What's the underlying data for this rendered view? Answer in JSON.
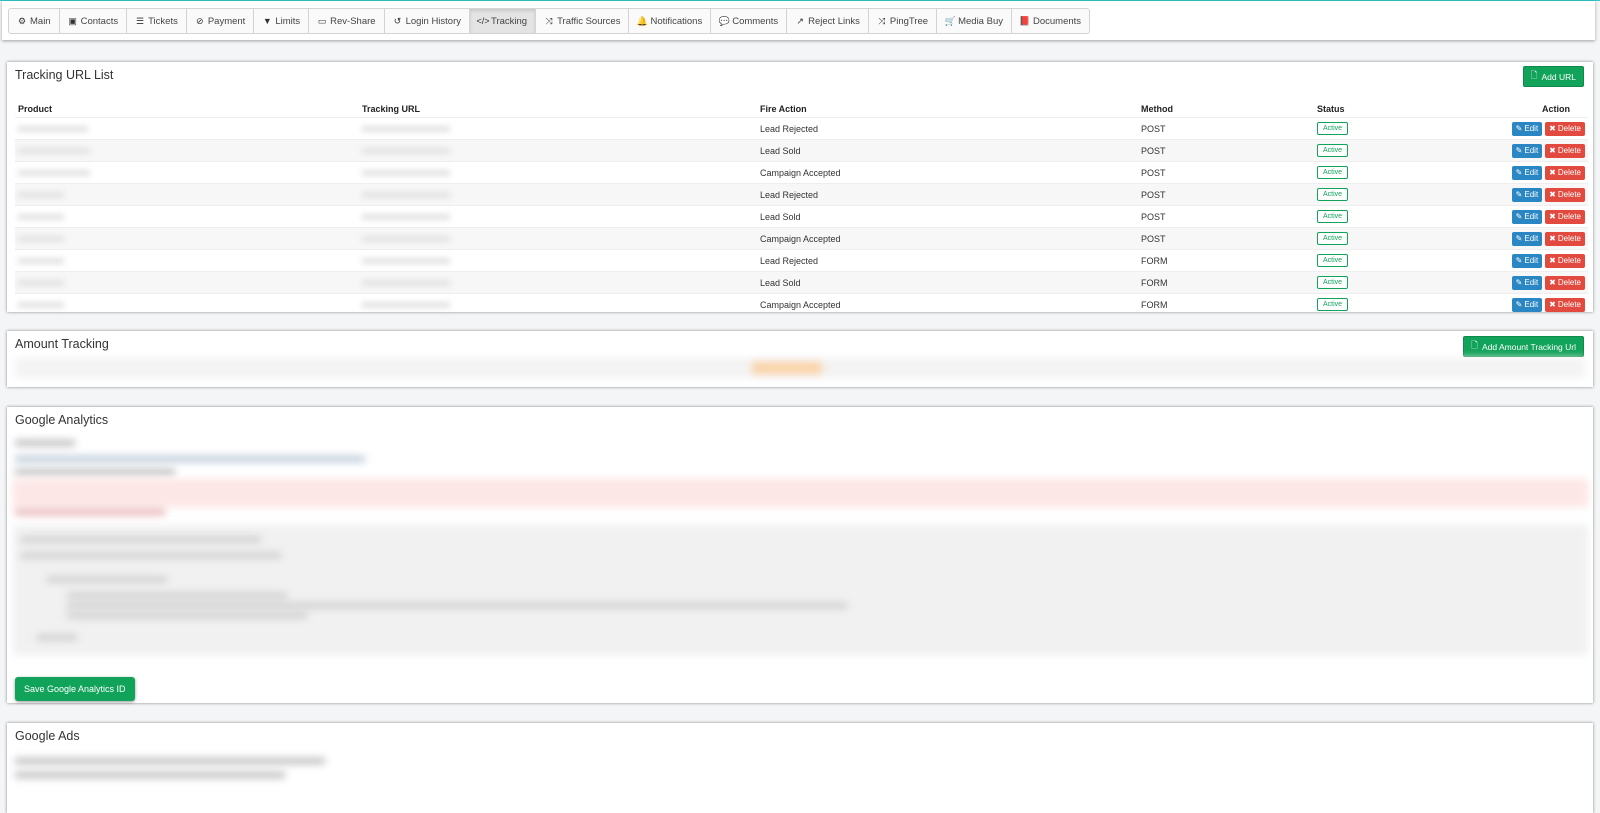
{
  "tabs": [
    {
      "label": "Main",
      "icon": "cogs-icon",
      "glyph": "⚙"
    },
    {
      "label": "Contacts",
      "icon": "address-book-icon",
      "glyph": "▣"
    },
    {
      "label": "Tickets",
      "icon": "list-icon",
      "glyph": "☰"
    },
    {
      "label": "Payment",
      "icon": "ban-icon",
      "glyph": "⊘"
    },
    {
      "label": "Limits",
      "icon": "filter-icon",
      "glyph": "▼"
    },
    {
      "label": "Rev-Share",
      "icon": "money-icon",
      "glyph": "▭"
    },
    {
      "label": "Login History",
      "icon": "history-icon",
      "glyph": "↺"
    },
    {
      "label": "Tracking",
      "icon": "code-icon",
      "glyph": "</>"
    },
    {
      "label": "Traffic Sources",
      "icon": "random-icon",
      "glyph": "⤨"
    },
    {
      "label": "Notifications",
      "icon": "bell-icon",
      "glyph": "🔔"
    },
    {
      "label": "Comments",
      "icon": "comment-icon",
      "glyph": "💬"
    },
    {
      "label": "Reject Links",
      "icon": "external-link-icon",
      "glyph": "↗"
    },
    {
      "label": "PingTree",
      "icon": "random-icon",
      "glyph": "⤨"
    },
    {
      "label": "Media Buy",
      "icon": "cart-icon",
      "glyph": "🛒"
    },
    {
      "label": "Documents",
      "icon": "book-icon",
      "glyph": "📕"
    }
  ],
  "active_tab": "Tracking",
  "tracking": {
    "title": "Tracking URL List",
    "add_button": "Add URL",
    "columns": {
      "product": "Product",
      "url": "Tracking URL",
      "fire": "Fire Action",
      "method": "Method",
      "status": "Status",
      "action": "Action"
    },
    "rows": [
      {
        "fire": "Lead Rejected",
        "method": "POST",
        "status": "Active"
      },
      {
        "fire": "Lead Sold",
        "method": "POST",
        "status": "Active"
      },
      {
        "fire": "Campaign Accepted",
        "method": "POST",
        "status": "Active"
      },
      {
        "fire": "Lead Rejected",
        "method": "POST",
        "status": "Active"
      },
      {
        "fire": "Lead Sold",
        "method": "POST",
        "status": "Active"
      },
      {
        "fire": "Campaign Accepted",
        "method": "POST",
        "status": "Active"
      },
      {
        "fire": "Lead Rejected",
        "method": "FORM",
        "status": "Active"
      },
      {
        "fire": "Lead Sold",
        "method": "FORM",
        "status": "Active"
      },
      {
        "fire": "Campaign Accepted",
        "method": "FORM",
        "status": "Active"
      }
    ],
    "edit_label": "Edit",
    "delete_label": "Delete"
  },
  "amount": {
    "title": "Amount Tracking",
    "add_button": "Add Amount Tracking Url"
  },
  "ga": {
    "title": "Google Analytics",
    "save_button": "Save Google Analytics ID"
  },
  "ads": {
    "title": "Google Ads"
  },
  "colors": {
    "accent": "#12a35a",
    "edit": "#2b86c4",
    "delete": "#e24a3f",
    "topline": "#2fc6c6"
  }
}
